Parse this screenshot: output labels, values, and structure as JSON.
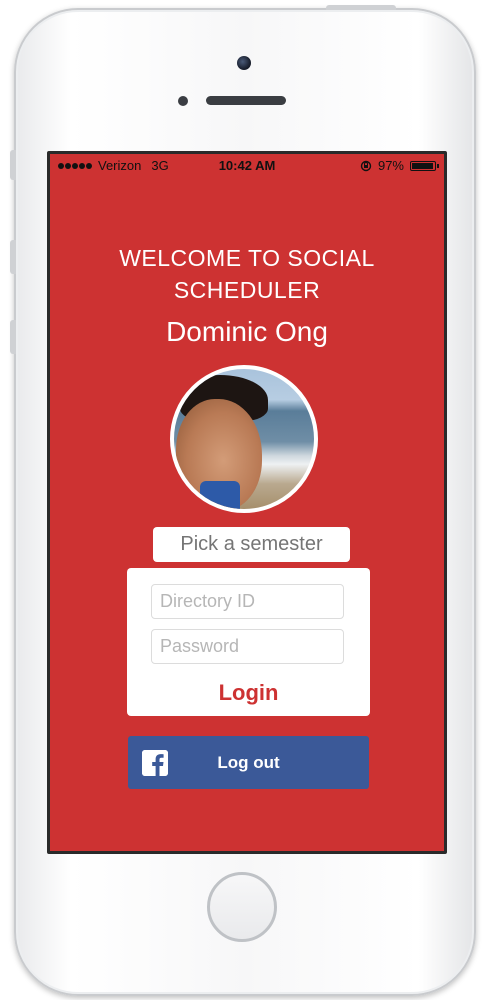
{
  "status_bar": {
    "carrier": "Verizon",
    "network": "3G",
    "time": "10:42 AM",
    "battery": "97%",
    "battery_level": 0.97
  },
  "welcome": {
    "line1": "WELCOME TO SOCIAL",
    "line2": "SCHEDULER"
  },
  "user": {
    "name": "Dominic Ong"
  },
  "semester": {
    "placeholder": "Pick a semester"
  },
  "login": {
    "directory_placeholder": "Directory ID",
    "password_placeholder": "Password",
    "button_label": "Login"
  },
  "facebook": {
    "label": "Log out",
    "icon": "facebook-icon"
  },
  "colors": {
    "background": "#cd3232",
    "facebook": "#3b5998",
    "text_light": "#ffffff"
  }
}
